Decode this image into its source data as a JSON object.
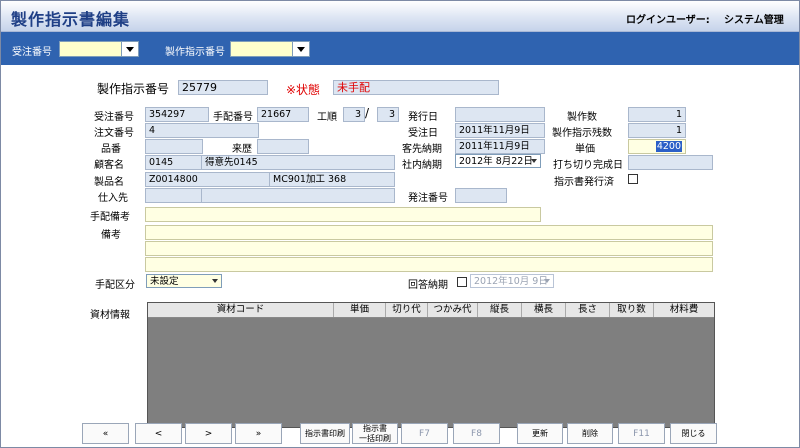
{
  "header": {
    "title": "製作指示書編集",
    "user_label": "ログインユーザー:",
    "user_name": "システム管理"
  },
  "filter": {
    "order_no_label": "受注番号",
    "order_no_value": "",
    "instruction_no_label": "製作指示番号",
    "instruction_no_value": ""
  },
  "form": {
    "instruction_no_label": "製作指示番号",
    "instruction_no": "25779",
    "status_label": "※状態",
    "status": "未手配",
    "order_no_label": "受注番号",
    "order_no": "354297",
    "arrange_no_label": "手配番号",
    "arrange_no": "21667",
    "process_label": "工順",
    "process_current": "3",
    "process_sep": "/",
    "process_total": "3",
    "issue_date_label": "発行日",
    "issue_date": "",
    "qty_label": "製作数",
    "qty": "1",
    "po_no_label": "注文番号",
    "po_no": "4",
    "order_date_label": "受注日",
    "order_date": "2011年11月9日",
    "remaining_label": "製作指示残数",
    "remaining": "1",
    "item_no_label": "品番",
    "item_no": "",
    "history_label": "来歴",
    "history": "",
    "customer_due_label": "客先納期",
    "customer_due": "2011年11月9日",
    "unit_price_label": "単価",
    "unit_price": "4200",
    "customer_label": "顧客名",
    "customer_code": "0145",
    "customer_name": "得意先0145",
    "internal_due_label": "社内納期",
    "internal_due": "2012年  8月22日",
    "cutoff_label": "打ち切り完成日",
    "cutoff": "",
    "product_label": "製品名",
    "product_code": "Z0014800",
    "product_name": "MC901加工  368",
    "instruction_issued_label": "指示書発行済",
    "supplier_label": "仕入先",
    "supplier_code": "",
    "supplier_name": "",
    "purchase_no_label": "発注番号",
    "purchase_no": "",
    "arrange_note_label": "手配備考",
    "arrange_note": "",
    "remarks_label": "備考",
    "remarks1": "",
    "remarks2": "",
    "remarks3": "",
    "arrange_type_label": "手配区分",
    "arrange_type": "未設定",
    "reply_due_label": "回答納期",
    "reply_due": "2012年10月  9日"
  },
  "materials": {
    "label": "資材情報",
    "columns": [
      "資材コード",
      "単価",
      "切り代",
      "つかみ代",
      "縦長",
      "横長",
      "長さ",
      "取り数",
      "材料費"
    ]
  },
  "buttons": {
    "first": "«",
    "prev": "<",
    "next": ">",
    "last": "»",
    "print_label": "指示書印刷",
    "print_list_line1": "指示書",
    "print_list_line2": "一括印刷",
    "f7": "F7",
    "f8": "F8",
    "update": "更新",
    "delete": "削除",
    "f11": "F11",
    "close": "閉じる"
  },
  "colors": {
    "filter_bar": "#2f63b0",
    "title_text": "#1f3f86",
    "field_bg": "#dde6f2",
    "note_bg": "#ffffe3",
    "status_red": "#e00000"
  }
}
